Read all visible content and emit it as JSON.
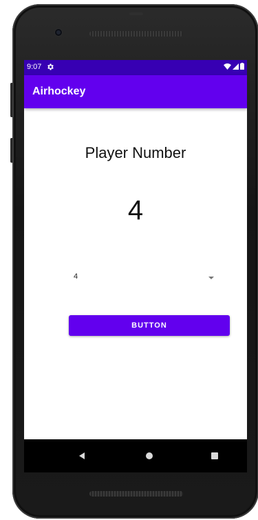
{
  "status_bar": {
    "time": "9:07",
    "icons": [
      "settings-icon",
      "wifi-icon",
      "signal-icon",
      "battery-icon"
    ]
  },
  "app_bar": {
    "title": "Airhockey"
  },
  "main": {
    "heading": "Player Number",
    "player_number": "4",
    "spinner": {
      "selected_value": "4"
    },
    "button_label": "BUTTON"
  },
  "nav_bar": {
    "icons": [
      "back-icon",
      "home-icon",
      "recents-icon"
    ]
  },
  "colors": {
    "status_bar": "#3700b3",
    "app_bar": "#6200ee",
    "button": "#6200ee",
    "background": "#ffffff"
  }
}
